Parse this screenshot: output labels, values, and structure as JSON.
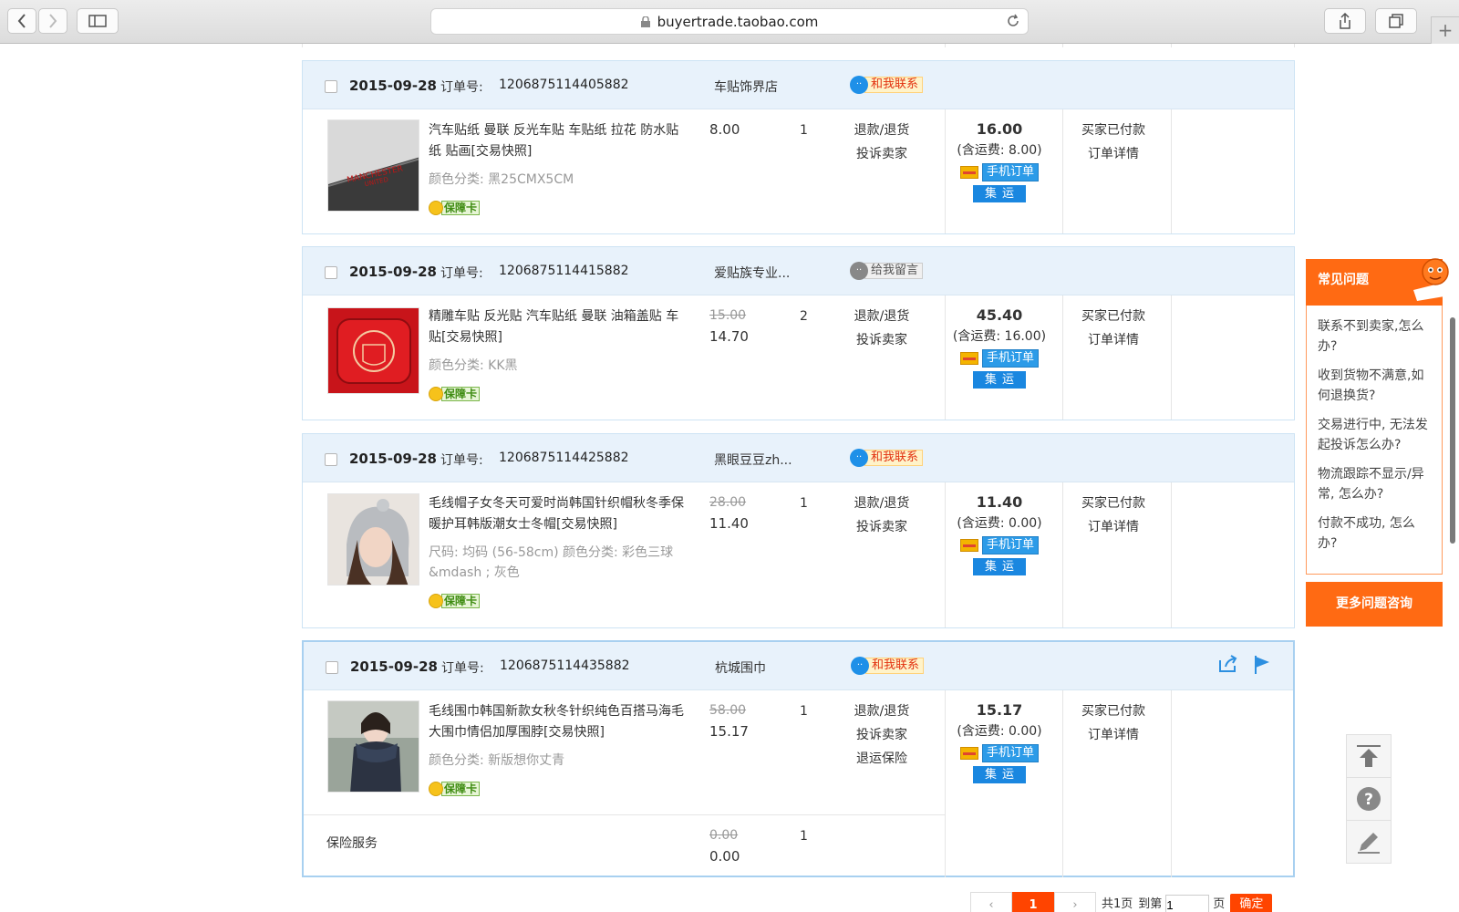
{
  "browser": {
    "url": "buyertrade.taobao.com"
  },
  "orders": [
    {
      "date": "2015-09-28",
      "order_label": "订单号:",
      "order_no": "1206875114405882",
      "shop": "车贴饰界店",
      "contact": "和我联系",
      "title": "汽车贴纸 曼联 反光车贴 车贴纸 拉花 防水贴纸 贴画[交易快照]",
      "attrs": "颜色分类:   黑25CMX5CM",
      "badge": "保障卡",
      "price_old": "",
      "price": "8.00",
      "qty": "1",
      "ops": [
        "退款/退货",
        "投诉卖家"
      ],
      "total": "16.00",
      "shipping": "(含运费:  8.00)",
      "mobile": "手机订单",
      "jiyun": "集运",
      "status": [
        "买家已付款",
        "订单详情"
      ]
    },
    {
      "date": "2015-09-28",
      "order_label": "订单号:",
      "order_no": "1206875114415882",
      "shop": "爱贴族专业...",
      "contact": "给我留言",
      "title": "精雕车贴 反光贴 汽车贴纸 曼联 油箱盖贴 车贴[交易快照]",
      "attrs": "颜色分类:   KK黑",
      "badge": "保障卡",
      "price_old": "15.00",
      "price": "14.70",
      "qty": "2",
      "ops": [
        "退款/退货",
        "投诉卖家"
      ],
      "total": "45.40",
      "shipping": "(含运费:  16.00)",
      "mobile": "手机订单",
      "jiyun": "集运",
      "status": [
        "买家已付款",
        "订单详情"
      ]
    },
    {
      "date": "2015-09-28",
      "order_label": "订单号:",
      "order_no": "1206875114425882",
      "shop": "黑眼豆豆zh...",
      "contact": "和我联系",
      "title": "毛线帽子女冬天可爱时尚韩国针织帽秋冬季保暖护耳韩版潮女士冬帽[交易快照]",
      "attrs": "尺码:  均码 (56-58cm)   颜色分类:  彩色三球&mdash ; 灰色",
      "badge": "保障卡",
      "price_old": "28.00",
      "price": "11.40",
      "qty": "1",
      "ops": [
        "退款/退货",
        "投诉卖家"
      ],
      "total": "11.40",
      "shipping": "(含运费:  0.00)",
      "mobile": "手机订单",
      "jiyun": "集运",
      "status": [
        "买家已付款",
        "订单详情"
      ]
    },
    {
      "date": "2015-09-28",
      "order_label": "订单号:",
      "order_no": "1206875114435882",
      "shop": "杭城围巾",
      "contact": "和我联系",
      "title": "毛线围巾韩国新款女秋冬针织纯色百搭马海毛大围巾情侣加厚围脖[交易快照]",
      "attrs": "颜色分类:   新版想你丈青",
      "badge": "保障卡",
      "price_old": "58.00",
      "price": "15.17",
      "qty": "1",
      "ops": [
        "退款/退货",
        "投诉卖家",
        "退运保险"
      ],
      "total": "15.17",
      "shipping": "(含运费:  0.00)",
      "mobile": "手机订单",
      "jiyun": "集运",
      "status": [
        "买家已付款",
        "订单详情"
      ],
      "insurance": {
        "label": "保险服务",
        "price_old": "0.00",
        "price": "0.00",
        "qty": "1"
      }
    }
  ],
  "faq": {
    "title": "常见问题",
    "items": [
      "联系不到卖家,怎么办?",
      "收到货物不满意,如何退换货?",
      "交易进行中, 无法发起投诉怎么办?",
      "物流跟踪不显示/异常, 怎么办?",
      "付款不成功, 怎么办?"
    ],
    "more": "更多问题咨询"
  },
  "pagination": {
    "current": "1",
    "info": "共1页",
    "goto": "到第",
    "input_value": "1",
    "page_unit": "页",
    "ok": "确定"
  },
  "colors": {
    "accent": "#ff6a13",
    "header_bg": "#e8f2fb",
    "link_blue": "#1a87e0"
  }
}
